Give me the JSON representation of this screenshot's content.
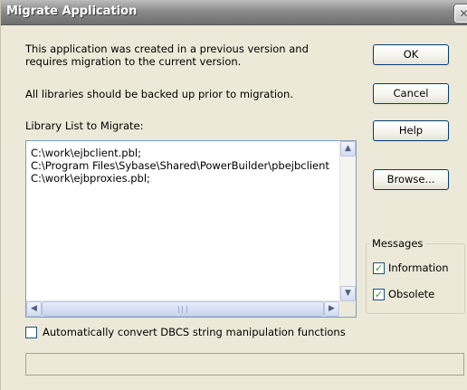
{
  "window": {
    "title": "Migrate Application",
    "close_glyph": "✕"
  },
  "intro": {
    "line1": "This application was created in a previous version and",
    "line2": "requires migration to the current version."
  },
  "backup_notice": "All libraries should be backed up prior to migration.",
  "library_list": {
    "label": "Library List to Migrate:",
    "items": [
      "C:\\work\\ejbclient.pbl;",
      "C:\\Program Files\\Sybase\\Shared\\PowerBuilder\\pbejbclient",
      "C:\\work\\ejbproxies.pbl;"
    ]
  },
  "buttons": {
    "ok": "OK",
    "cancel": "Cancel",
    "help": "Help",
    "browse": "Browse..."
  },
  "messages": {
    "group_label": "Messages",
    "information": {
      "label": "Information",
      "checked": true
    },
    "obsolete": {
      "label": "Obsolete",
      "checked": true
    }
  },
  "dbcs": {
    "label": "Automatically convert DBCS string manipulation functions",
    "checked": false
  },
  "status_text": "",
  "icons": {
    "scroll_up": "▲",
    "scroll_down": "▼",
    "scroll_left": "◀",
    "scroll_right": "▶",
    "check": "✓"
  }
}
